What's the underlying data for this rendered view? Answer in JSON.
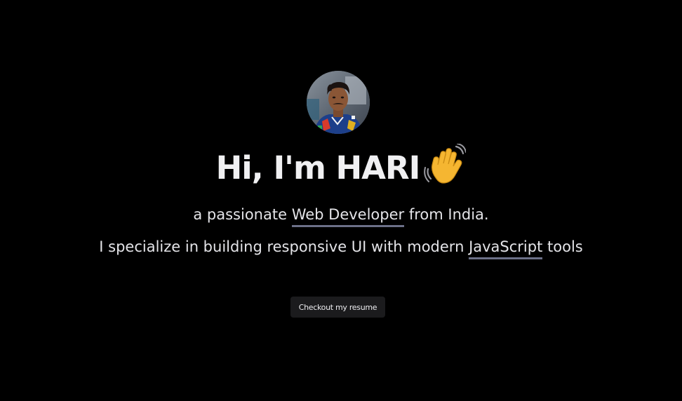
{
  "hero": {
    "avatar_alt": "profile photo",
    "greeting": "Hi, I'm HARI",
    "wave_icon": "waving-hand-icon",
    "line1": {
      "before": "a passionate ",
      "highlight": "Web Developer",
      "after": " from India."
    },
    "line2": {
      "before": "I specialize in building responsive UI with modern ",
      "highlight": "JavaScript",
      "after": " tools"
    },
    "resume_button": "Checkout my resume"
  },
  "colors": {
    "background": "#000000",
    "text": "#e9e9ec",
    "underline": "#6c7088",
    "button_bg": "#1b1b1d"
  }
}
